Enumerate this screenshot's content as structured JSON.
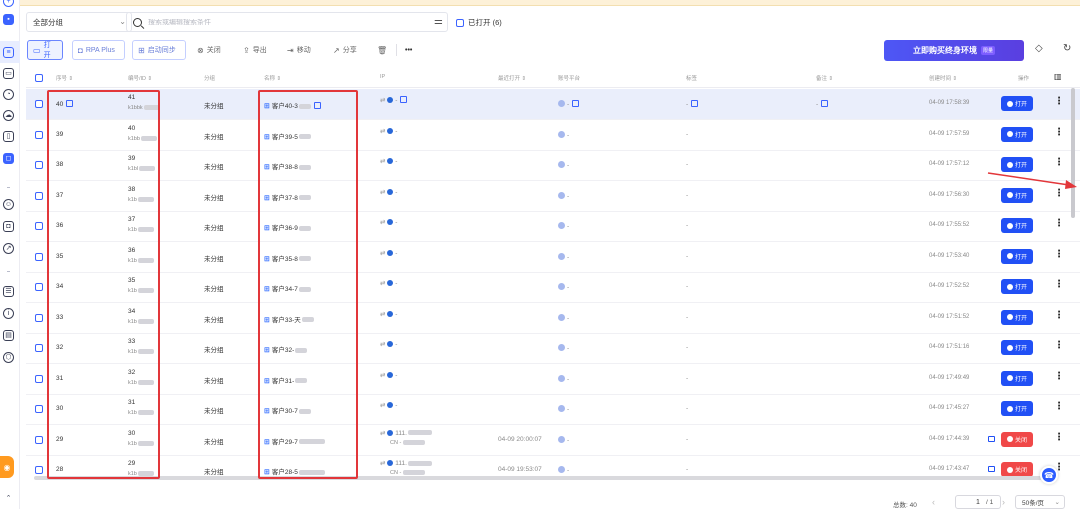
{
  "filter": {
    "group_select": "全部分组",
    "search_placeholder": "搜索或编辑搜索条件",
    "opened_only": "已打开 (6)"
  },
  "toolbar": {
    "open": "打开",
    "rpa": "RPA Plus",
    "sync": "启动同步",
    "close": "关闭",
    "export": "导出",
    "move": "移动",
    "share": "分享",
    "more": "•••",
    "buy": "立即购买终身环境",
    "buy_tag": "限量"
  },
  "columns": {
    "serial": "序号 ⇕",
    "code": "编号/ID ⇕",
    "group": "分组",
    "name": "名称 ⇕",
    "ip": "IP",
    "last_open": "最近打开 ⇕",
    "platform": "账号平台",
    "tags": "标签",
    "remark": "备注 ⇕",
    "created": "创建时间 ⇕",
    "actions": "操作"
  },
  "rows": [
    {
      "serial": "40",
      "code_num": "41",
      "code_str": "k1bbk",
      "group": "未分组",
      "name": "客户40-3",
      "ip": "-",
      "ip2": "",
      "last_open": "",
      "platform": "-",
      "tags": "-",
      "remark": "-",
      "created": "04-09 17:58:39",
      "action": "打开"
    },
    {
      "serial": "39",
      "code_num": "40",
      "code_str": "k1bb",
      "group": "未分组",
      "name": "客户39-5",
      "ip": "-",
      "ip2": "",
      "last_open": "",
      "platform": "-",
      "tags": "-",
      "remark": "",
      "created": "04-09 17:57:59",
      "action": "打开"
    },
    {
      "serial": "38",
      "code_num": "39",
      "code_str": "k1bl",
      "group": "未分组",
      "name": "客户38-8",
      "ip": "-",
      "ip2": "",
      "last_open": "",
      "platform": "-",
      "tags": "-",
      "remark": "",
      "created": "04-09 17:57:12",
      "action": "打开"
    },
    {
      "serial": "37",
      "code_num": "38",
      "code_str": "k1b",
      "group": "未分组",
      "name": "客户37-8",
      "ip": "-",
      "ip2": "",
      "last_open": "",
      "platform": "-",
      "tags": "-",
      "remark": "",
      "created": "04-09 17:56:30",
      "action": "打开"
    },
    {
      "serial": "36",
      "code_num": "37",
      "code_str": "k1b",
      "group": "未分组",
      "name": "客户36-9",
      "ip": "-",
      "ip2": "",
      "last_open": "",
      "platform": "-",
      "tags": "-",
      "remark": "",
      "created": "04-09 17:55:52",
      "action": "打开"
    },
    {
      "serial": "35",
      "code_num": "36",
      "code_str": "k1b",
      "group": "未分组",
      "name": "客户35-8",
      "ip": "-",
      "ip2": "",
      "last_open": "",
      "platform": "-",
      "tags": "-",
      "remark": "",
      "created": "04-09 17:53:40",
      "action": "打开"
    },
    {
      "serial": "34",
      "code_num": "35",
      "code_str": "k1b",
      "group": "未分组",
      "name": "客户34-7",
      "ip": "-",
      "ip2": "",
      "last_open": "",
      "platform": "-",
      "tags": "-",
      "remark": "",
      "created": "04-09 17:52:52",
      "action": "打开"
    },
    {
      "serial": "33",
      "code_num": "34",
      "code_str": "k1b",
      "group": "未分组",
      "name": "客户33-天",
      "ip": "-",
      "ip2": "",
      "last_open": "",
      "platform": "-",
      "tags": "-",
      "remark": "",
      "created": "04-09 17:51:52",
      "action": "打开"
    },
    {
      "serial": "32",
      "code_num": "33",
      "code_str": "k1b",
      "group": "未分组",
      "name": "客户32-",
      "ip": "-",
      "ip2": "",
      "last_open": "",
      "platform": "-",
      "tags": "-",
      "remark": "",
      "created": "04-09 17:51:16",
      "action": "打开"
    },
    {
      "serial": "31",
      "code_num": "32",
      "code_str": "k1b",
      "group": "未分组",
      "name": "客户31-",
      "ip": "-",
      "ip2": "",
      "last_open": "",
      "platform": "-",
      "tags": "-",
      "remark": "",
      "created": "04-09 17:49:49",
      "action": "打开"
    },
    {
      "serial": "30",
      "code_num": "31",
      "code_str": "k1b",
      "group": "未分组",
      "name": "客户30-7",
      "ip": "-",
      "ip2": "",
      "last_open": "",
      "platform": "-",
      "tags": "-",
      "remark": "",
      "created": "04-09 17:45:27",
      "action": "打开"
    },
    {
      "serial": "29",
      "code_num": "30",
      "code_str": "k1b",
      "group": "未分组",
      "name": "客户29-7",
      "ip": "111.",
      "ip2": "CN -",
      "last_open": "04-09 20:00:07",
      "platform": "-",
      "tags": "-",
      "remark": "",
      "created": "04-09 17:44:39",
      "action": "关闭"
    },
    {
      "serial": "28",
      "code_num": "29",
      "code_str": "k1b",
      "group": "未分组",
      "name": "客户28-5",
      "ip": "111.",
      "ip2": "CN -",
      "last_open": "04-09 19:53:07",
      "platform": "-",
      "tags": "-",
      "remark": "",
      "created": "04-09 17:43:47",
      "action": "关闭"
    }
  ],
  "footer": {
    "total": "总数: 40",
    "page": "1",
    "page_of": "/ 1",
    "page_size": "50条/页"
  },
  "colors": {
    "primary": "#2150f5",
    "danger": "#f04848",
    "highlight": "#e2363a"
  }
}
